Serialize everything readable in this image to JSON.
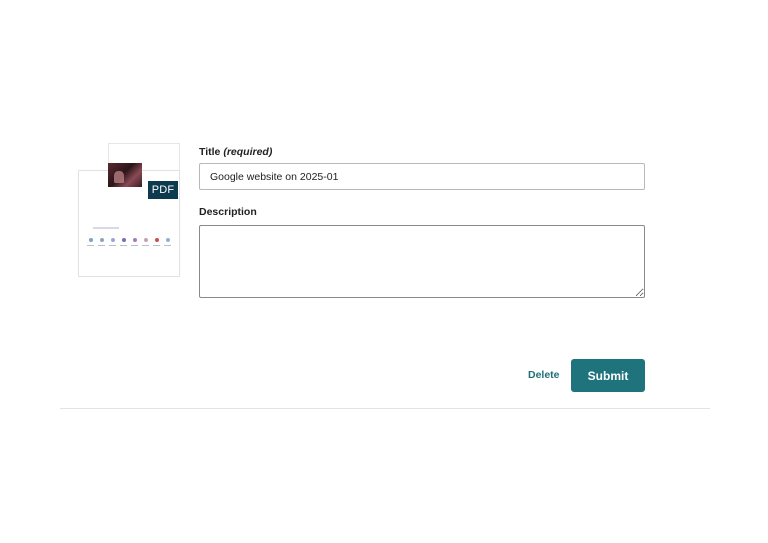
{
  "thumbnail": {
    "badge": "PDF",
    "icon": "pdf-document-thumbnail",
    "badge_color": "#0d3a4f",
    "dot_colors": [
      "#7fa0c8",
      "#8aa5c4",
      "#9aa8d0",
      "#7a6bb8",
      "#a37bc4",
      "#c7a0b8",
      "#c85050",
      "#8fb0d8"
    ]
  },
  "form": {
    "title_label": "Title",
    "title_required": "(required)",
    "title_value": "Google website on 2025-01",
    "description_label": "Description",
    "description_value": ""
  },
  "actions": {
    "delete_label": "Delete",
    "submit_label": "Submit",
    "accent_color": "#1f737c"
  }
}
